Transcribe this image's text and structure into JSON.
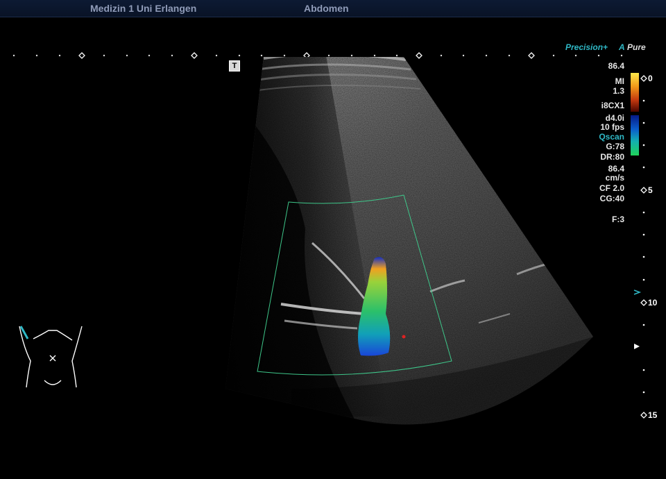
{
  "header": {
    "institution": "Medizin 1 Uni Erlangen",
    "exam": "Abdomen"
  },
  "brand": {
    "precision": "Precision+",
    "pure_mark": "A",
    "pure": "Pure"
  },
  "transducer_marker": "T",
  "params": {
    "vel_top": "86.4",
    "mi_label": "MI",
    "mi_value": "1.3",
    "probe": "i8CX1",
    "depth_mode": "d4.0i",
    "frame_rate": "10 fps",
    "qscan": "Qscan",
    "gain": "G:78",
    "dynamic_range": "DR:80",
    "vel_bottom": "86.4",
    "vel_unit": "cm/s",
    "color_freq": "CF 2.0",
    "color_gain": "CG:40",
    "focus": "F:3"
  },
  "depth_scale": {
    "labels": [
      "0",
      "5",
      "10",
      "15"
    ],
    "unit_marks": "diamond"
  },
  "colors": {
    "accent_cyan": "#2fb8c6",
    "color_box": "#3ec78a",
    "header_text": "#8f9bb8"
  },
  "icons": [
    "transducer-marker-icon",
    "body-marker-icon",
    "focus-marker-icon",
    "depth-marker-icon"
  ]
}
